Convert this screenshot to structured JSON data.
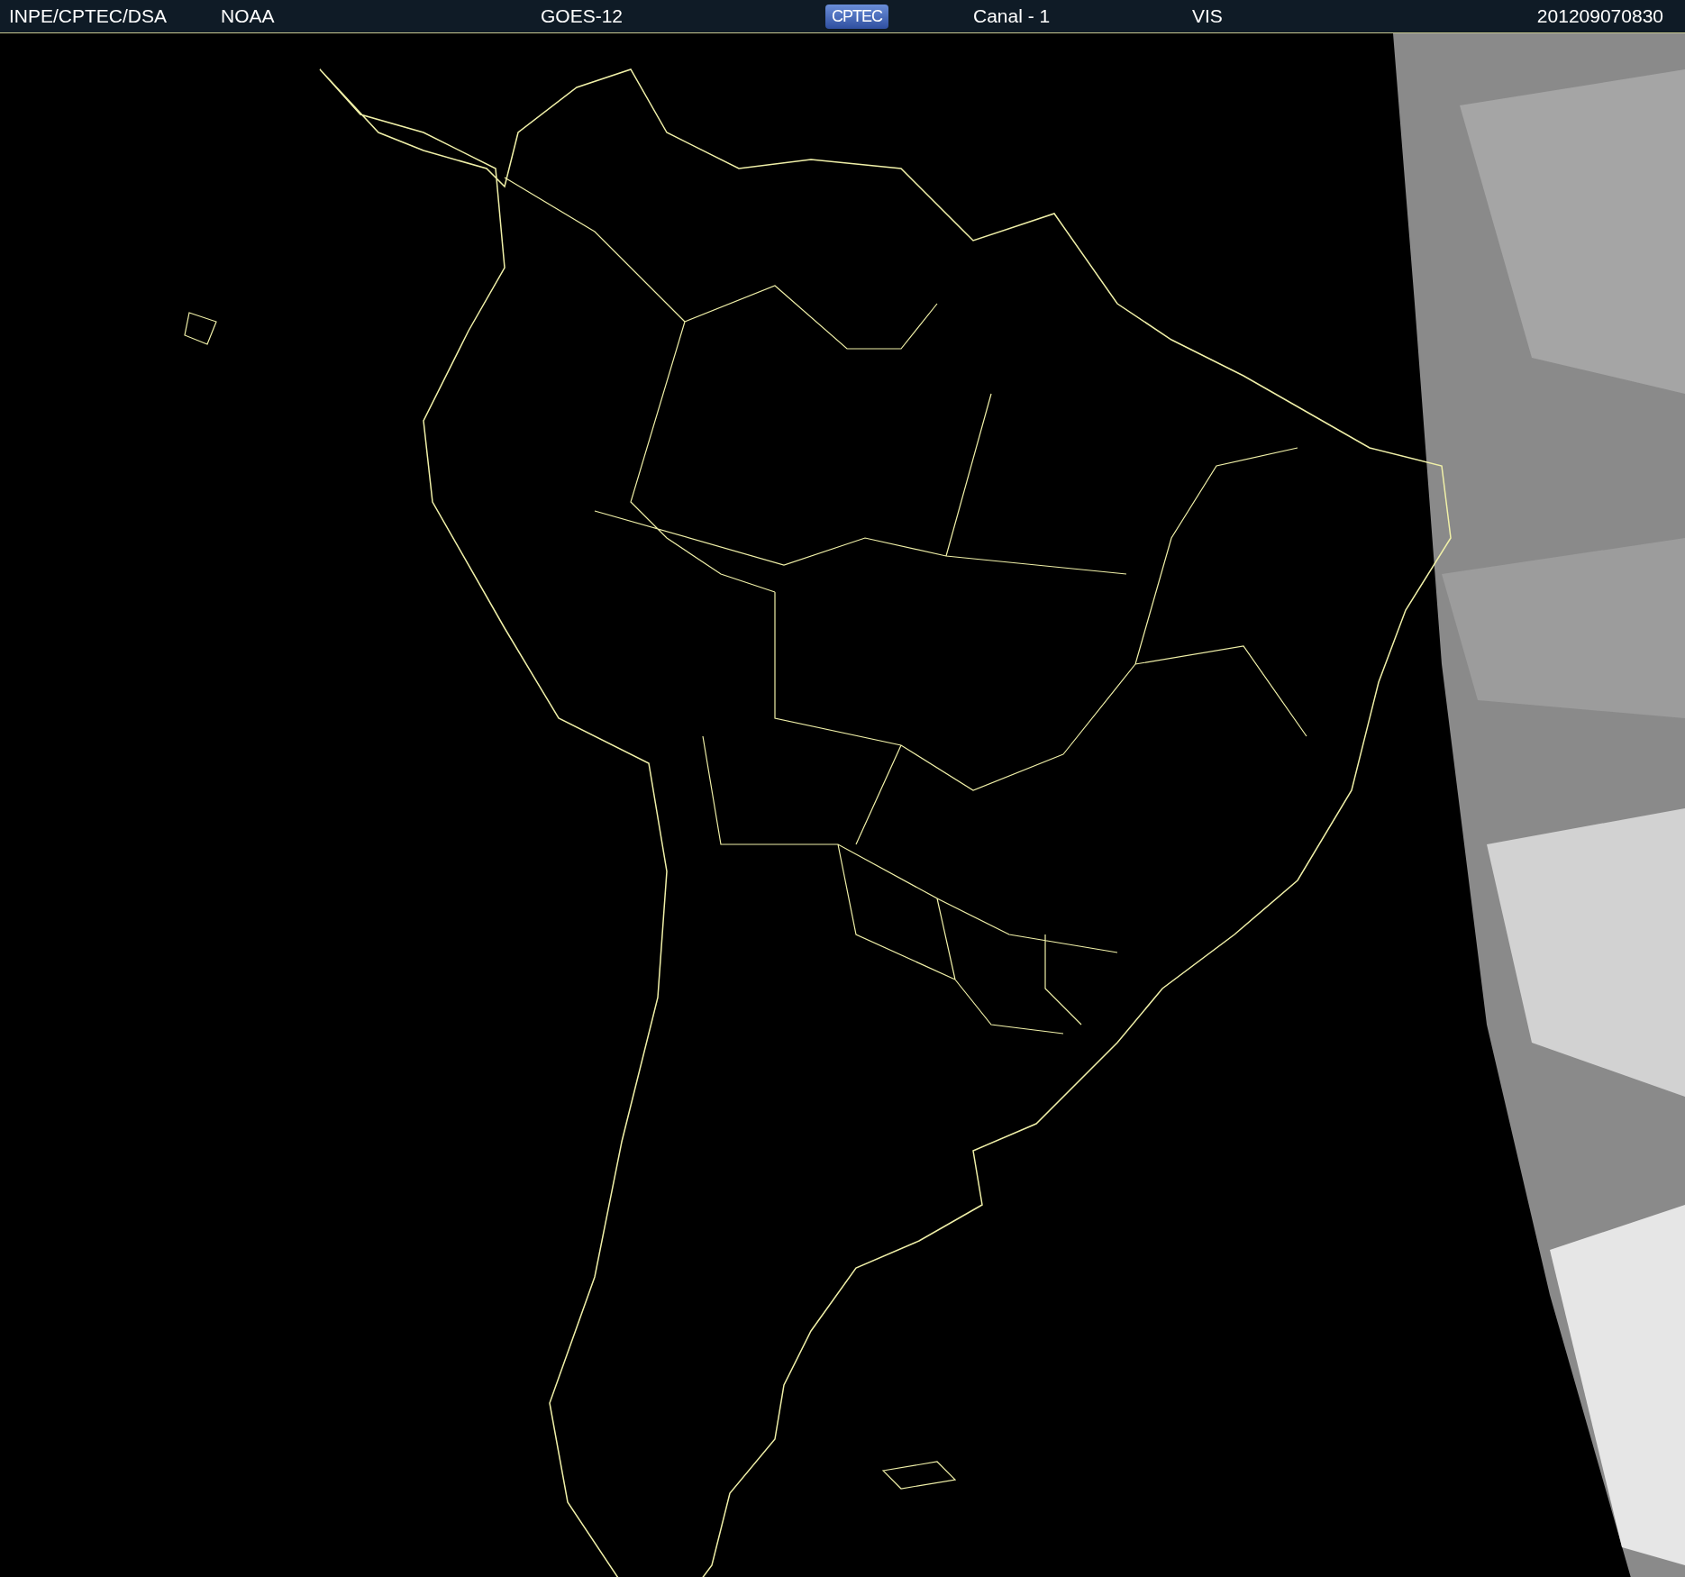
{
  "header": {
    "items": [
      {
        "kind": "text",
        "text": "INPE/CPTEC/DSA"
      },
      {
        "kind": "text",
        "text": "NOAA"
      },
      {
        "kind": "text",
        "text": "GOES-12"
      },
      {
        "kind": "logo",
        "text": "CPTEC"
      },
      {
        "kind": "text",
        "text": "Canal - 1"
      },
      {
        "kind": "text",
        "text": "VIS"
      },
      {
        "kind": "text",
        "text": "201209070830"
      }
    ]
  }
}
